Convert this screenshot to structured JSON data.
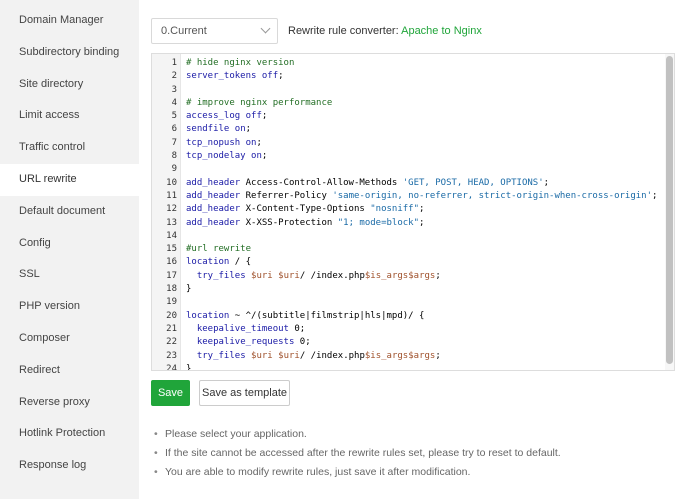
{
  "sidebar": {
    "items": [
      {
        "label": "Domain Manager",
        "active": false
      },
      {
        "label": "Subdirectory binding",
        "active": false
      },
      {
        "label": "Site directory",
        "active": false
      },
      {
        "label": "Limit access",
        "active": false
      },
      {
        "label": "Traffic control",
        "active": false
      },
      {
        "label": "URL rewrite",
        "active": true
      },
      {
        "label": "Default document",
        "active": false
      },
      {
        "label": "Config",
        "active": false
      },
      {
        "label": "SSL",
        "active": false
      },
      {
        "label": "PHP version",
        "active": false
      },
      {
        "label": "Composer",
        "active": false
      },
      {
        "label": "Redirect",
        "active": false
      },
      {
        "label": "Reverse proxy",
        "active": false
      },
      {
        "label": "Hotlink Protection",
        "active": false
      },
      {
        "label": "Response log",
        "active": false
      }
    ]
  },
  "toolbar": {
    "select_value": "0.Current",
    "converter_label": "Rewrite rule converter: ",
    "converter_link": "Apache to Nginx"
  },
  "editor": {
    "lines": [
      "# hide nginx version",
      "server_tokens off;",
      "",
      "# improve nginx performance",
      "access_log off;",
      "sendfile on;",
      "tcp_nopush on;",
      "tcp_nodelay on;",
      "",
      "add_header Access-Control-Allow-Methods 'GET, POST, HEAD, OPTIONS';",
      "add_header Referrer-Policy 'same-origin, no-referrer, strict-origin-when-cross-origin';",
      "add_header X-Content-Type-Options \"nosniff\";",
      "add_header X-XSS-Protection \"1; mode=block\";",
      "",
      "#url rewrite",
      "location / {",
      "  try_files $uri $uri/ /index.php$is_args$args;",
      "}",
      "",
      "location ~ ^/(subtitle|filmstrip|hls|mpd)/ {",
      "  keepalive_timeout 0;",
      "  keepalive_requests 0;",
      "  try_files $uri $uri/ /index.php$is_args$args;",
      "}"
    ]
  },
  "buttons": {
    "save": "Save",
    "save_template": "Save as template"
  },
  "tips": [
    "Please select your application.",
    "If the site cannot be accessed after the rewrite rules set, please try to reset to default.",
    "You are able to modify rewrite rules, just save it after modification."
  ],
  "colors": {
    "accent": "#20a53a",
    "sidebar_bg": "#f2f2f2"
  }
}
